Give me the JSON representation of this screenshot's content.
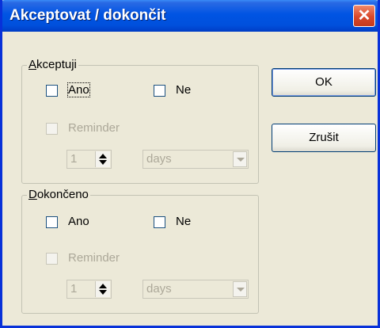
{
  "window": {
    "title": "Akceptovat / dokončit",
    "close_glyph": "✕"
  },
  "accepted_group": {
    "legend_underlined": "A",
    "legend_rest": "kceptuji",
    "yes_label": "Ano",
    "no_label": "Ne",
    "reminder_label": "Reminder",
    "reminder_value": "1",
    "reminder_unit": "days"
  },
  "done_group": {
    "legend_underlined": "D",
    "legend_rest": "okončeno",
    "yes_label": "Ano",
    "no_label": "Ne",
    "reminder_label": "Reminder",
    "reminder_value": "1",
    "reminder_unit": "days"
  },
  "buttons": {
    "ok_label": "OK",
    "cancel_label": "Zrušit"
  },
  "colors": {
    "titlebar": "#0054e3",
    "dialog_bg": "#ece9d8",
    "disabled_text": "#aca899",
    "close_button": "#d8482a"
  }
}
